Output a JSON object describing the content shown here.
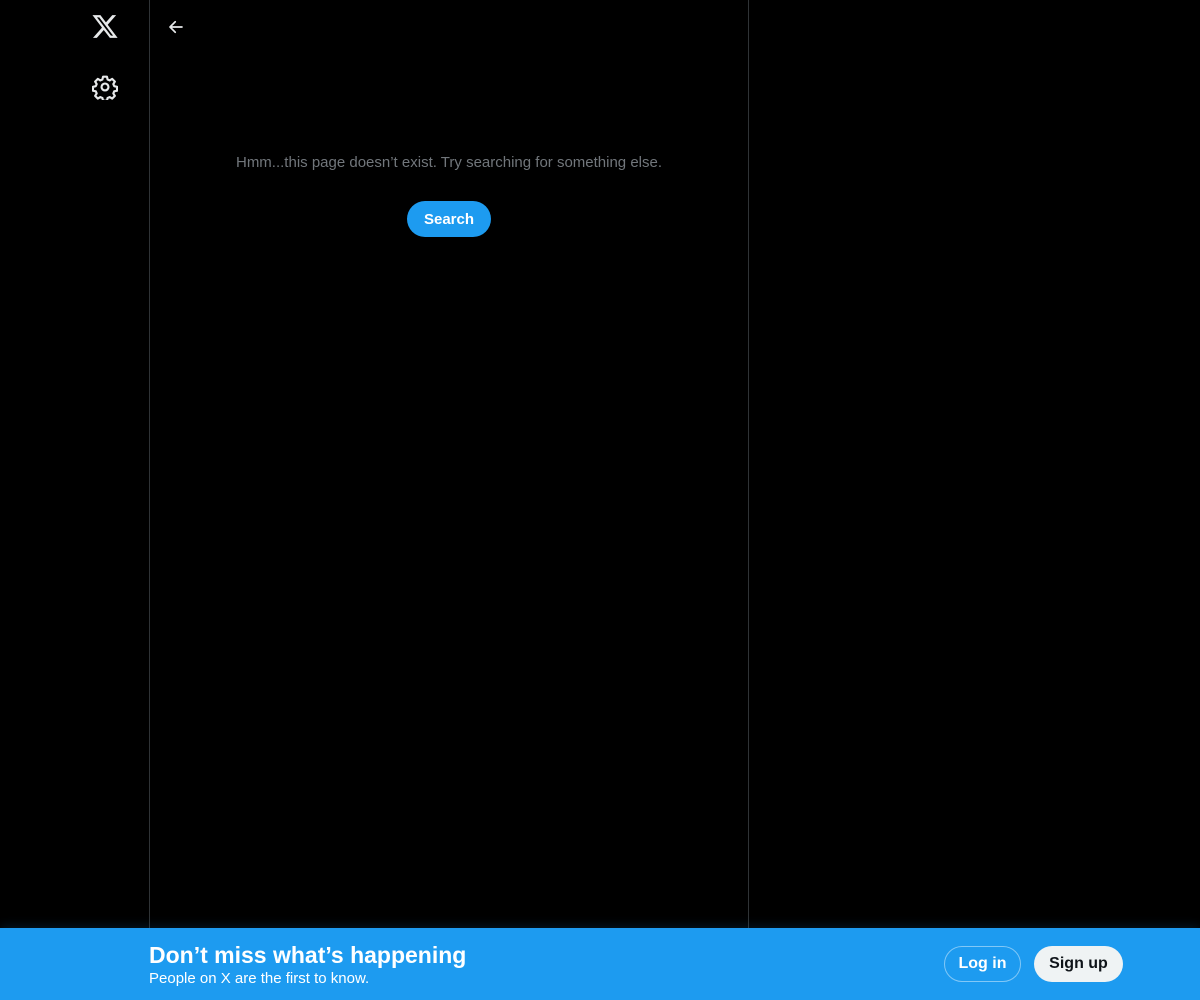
{
  "colors": {
    "background": "#000000",
    "border": "#2f3336",
    "muted_text": "#71767b",
    "accent": "#1d9bf0",
    "signup_bg": "#eff3f4",
    "signup_text": "#0f1419"
  },
  "icons": {
    "logo": "x-logo-icon",
    "settings": "gear-icon",
    "back": "arrow-left-icon"
  },
  "main": {
    "empty_message": "Hmm...this page doesn’t exist. Try searching for something else.",
    "search_label": "Search"
  },
  "banner": {
    "title": "Don’t miss what’s happening",
    "subtitle": "People on X are the first to know.",
    "login_label": "Log in",
    "signup_label": "Sign up"
  }
}
